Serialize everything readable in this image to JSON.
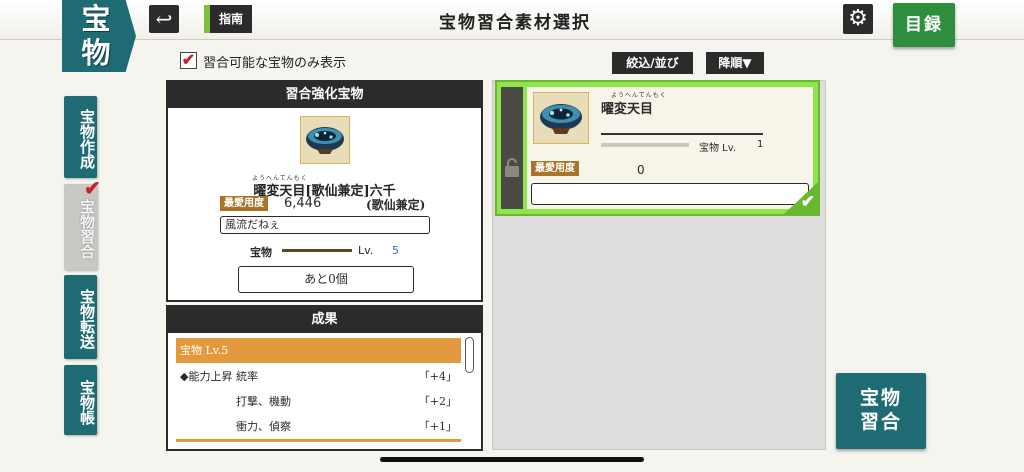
{
  "header": {
    "logo_top": "宝",
    "logo_bottom": "物",
    "back_icon": "↩",
    "guide_label": "指南",
    "title": "宝物習合素材選択",
    "settings_icon": "⚙",
    "catalog_label": "目録"
  },
  "sidebar": {
    "items": [
      {
        "label": "宝物作成"
      },
      {
        "label": "宝物習合"
      },
      {
        "label": "宝物転送"
      },
      {
        "label": "宝物帳"
      }
    ],
    "active_check": "✔"
  },
  "filter": {
    "checkbox_mark": "✔",
    "label": "習合可能な宝物のみ表示",
    "sort_label": "絞込/並び",
    "order_label": "降順▼"
  },
  "enhance_panel": {
    "header": "習合強化宝物",
    "furigana": "ようへんてんもく",
    "name": "曜変天目[歌仙兼定]六千",
    "love_tag": "最愛用度",
    "love_value": "6,446",
    "school": "(歌仙兼定)",
    "comment": "風流だねぇ",
    "treasure_label": "宝物",
    "lv_label": "Lv.",
    "lv_value": "5",
    "remaining": "あと0個"
  },
  "result_panel": {
    "header": "成果",
    "rows": [
      {
        "label": "宝物 Lv.5",
        "value": ""
      },
      {
        "label": "◆能力上昇 統率",
        "value": "「+4」"
      },
      {
        "label": "打撃、機動",
        "value": "「+2」"
      },
      {
        "label": "衝力、偵察",
        "value": "「+1」"
      }
    ]
  },
  "material_card": {
    "furigana": "ようへんてんもく",
    "name": "曜変天目",
    "lv_label": "宝物 Lv.",
    "lv_value": "1",
    "love_tag": "最愛用度",
    "love_value": "0",
    "lock_icon": "🔓",
    "selected_icon": "✔"
  },
  "fuse_button": {
    "line1": "宝物",
    "line2": "習合"
  }
}
